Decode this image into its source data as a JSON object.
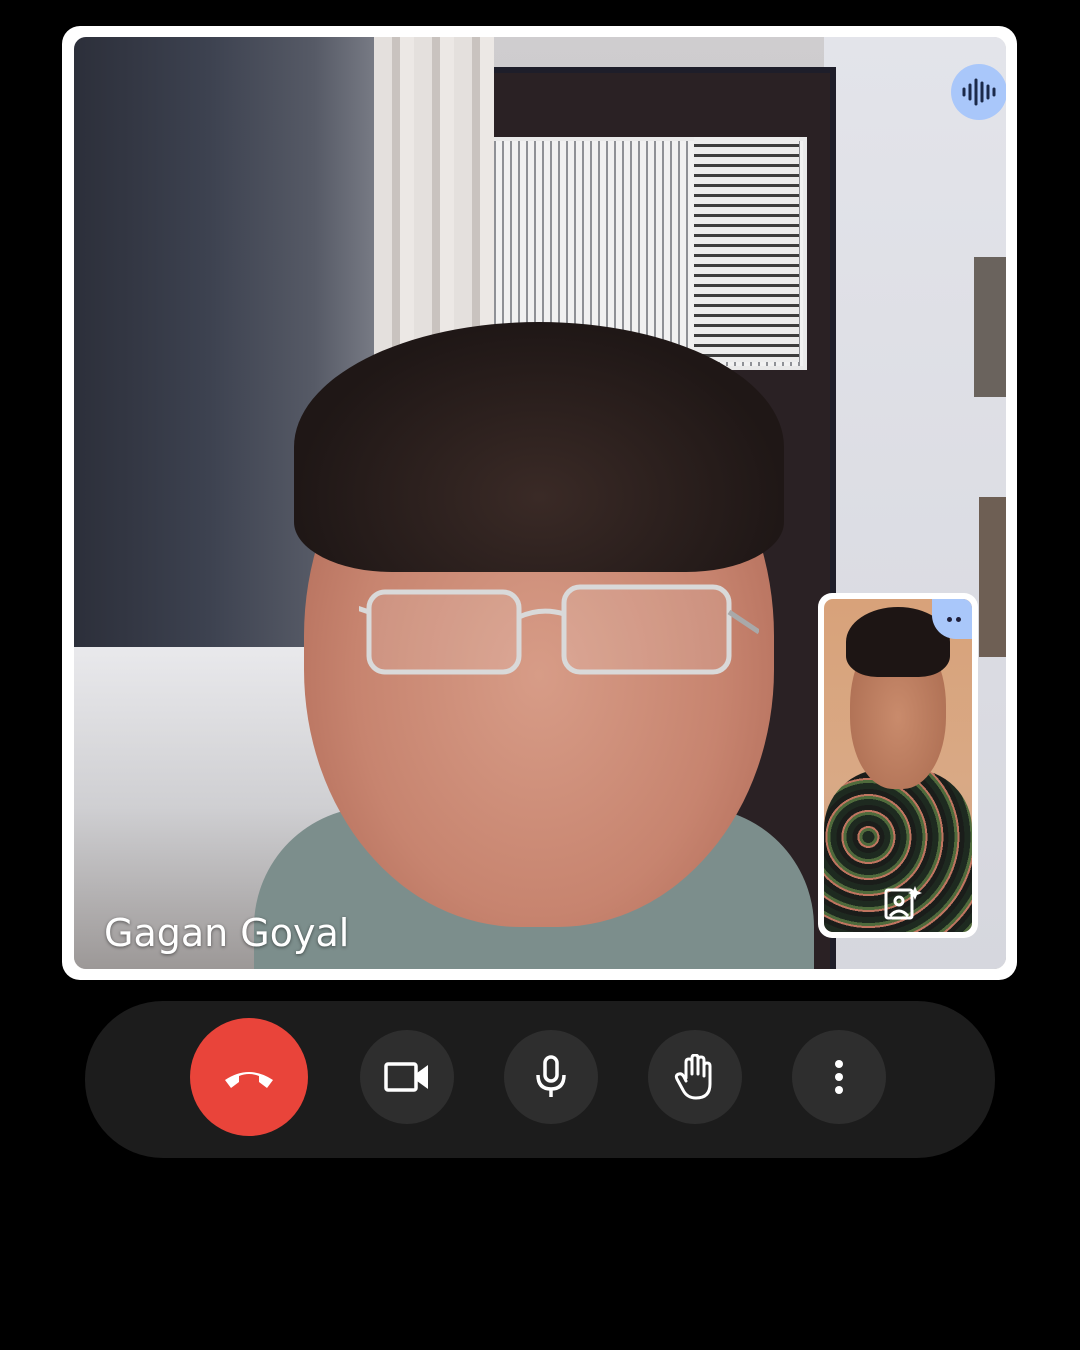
{
  "main_participant": {
    "name": "Gagan Goyal",
    "speaking_icon": "audio-waveform-icon"
  },
  "self_view": {
    "more_icon": "more-options-icon",
    "effects_icon": "visual-effects-icon"
  },
  "controls": [
    {
      "name": "end-call-button",
      "icon": "phone-hangup-icon",
      "color": "#e9443a"
    },
    {
      "name": "camera-button",
      "icon": "videocam-icon"
    },
    {
      "name": "microphone-button",
      "icon": "mic-icon"
    },
    {
      "name": "raise-hand-button",
      "icon": "hand-icon"
    },
    {
      "name": "more-options-button",
      "icon": "more-vert-icon"
    }
  ],
  "colors": {
    "accent": "#a9c7fa",
    "end_call": "#e9443a",
    "control_bg": "#2e2e2e",
    "bar_bg": "#1c1c1c"
  }
}
